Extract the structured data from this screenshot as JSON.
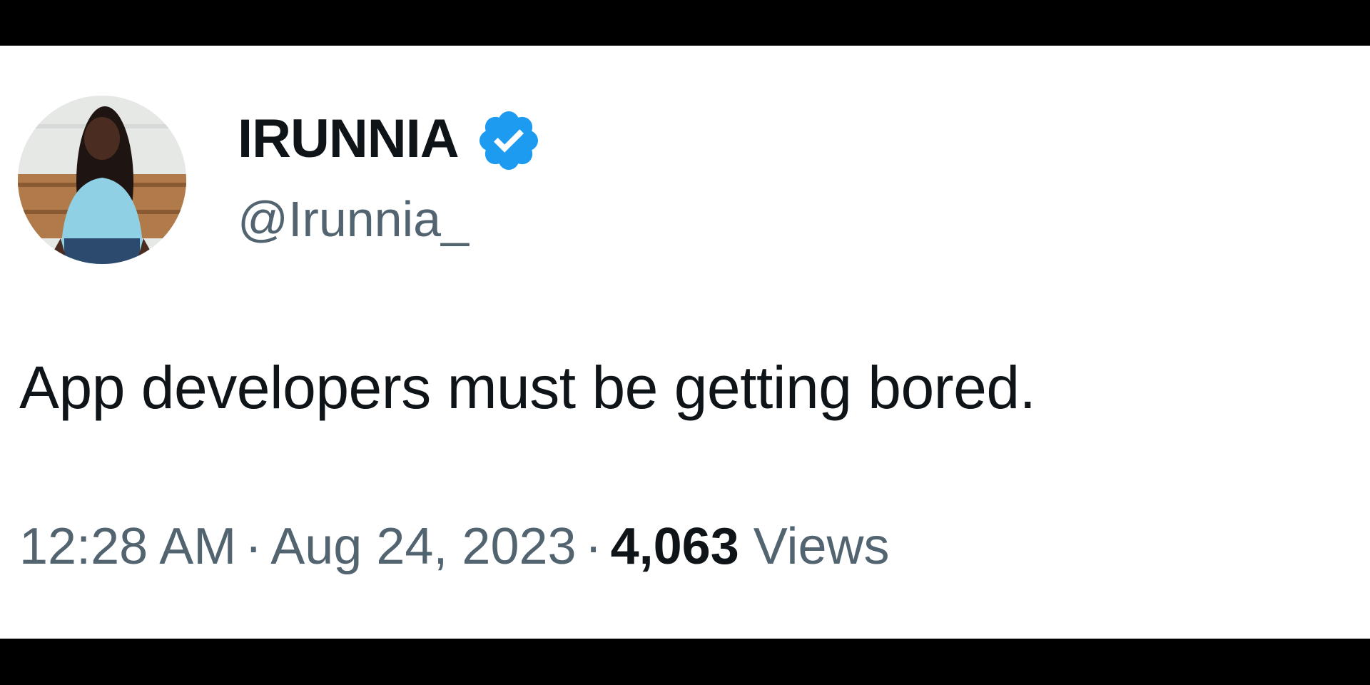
{
  "tweet": {
    "author": {
      "display_name": "IRUNNIA",
      "handle": "@Irunnia_",
      "verified": true,
      "verified_icon": "verified-badge-icon",
      "verified_color": "#1d9bf0"
    },
    "text": "App developers must be getting bored.",
    "meta": {
      "time": "12:28 AM",
      "separator": "·",
      "date": "Aug 24, 2023",
      "views_count": "4,063",
      "views_label": "Views"
    }
  },
  "colors": {
    "text_primary": "#0f1419",
    "text_secondary": "#536471",
    "background": "#ffffff",
    "letterbox": "#000000"
  }
}
